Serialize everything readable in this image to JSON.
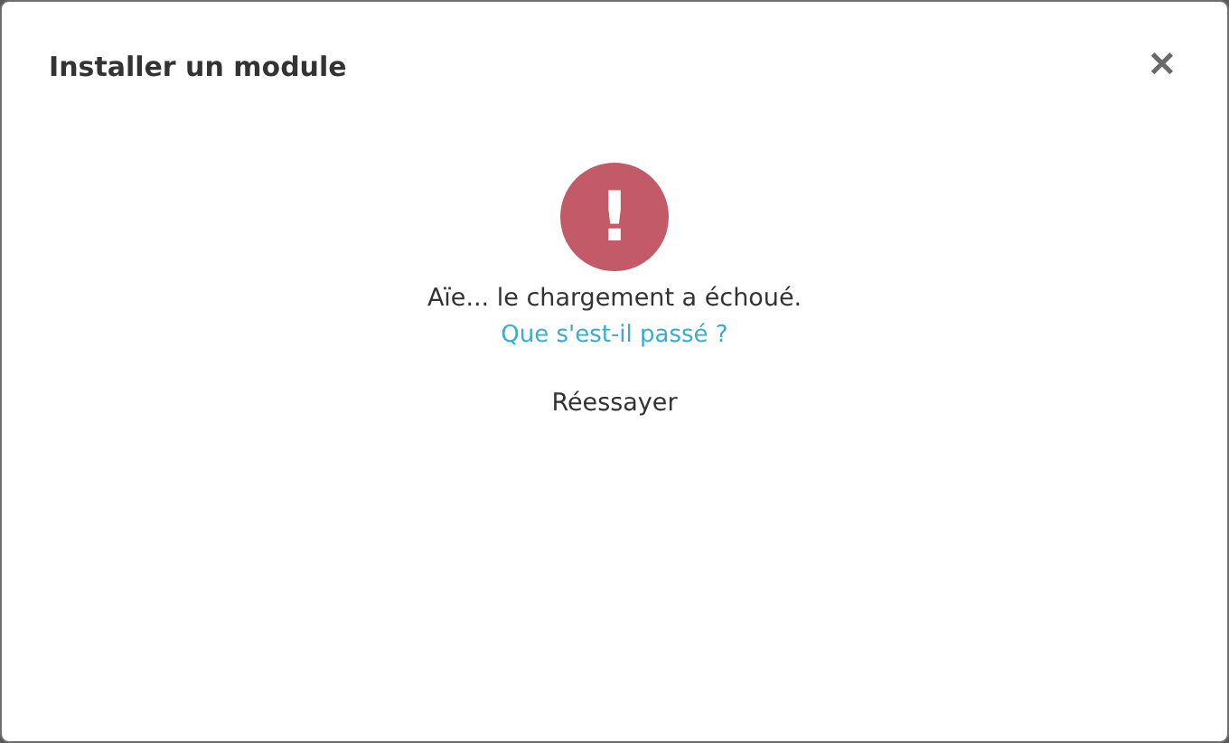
{
  "dialog": {
    "title": "Installer un module",
    "close": "✕"
  },
  "error": {
    "icon": "!",
    "message": "Aïe... le chargement a échoué.",
    "link": "Que s'est-il passé ?",
    "retry": "Réessayer"
  }
}
